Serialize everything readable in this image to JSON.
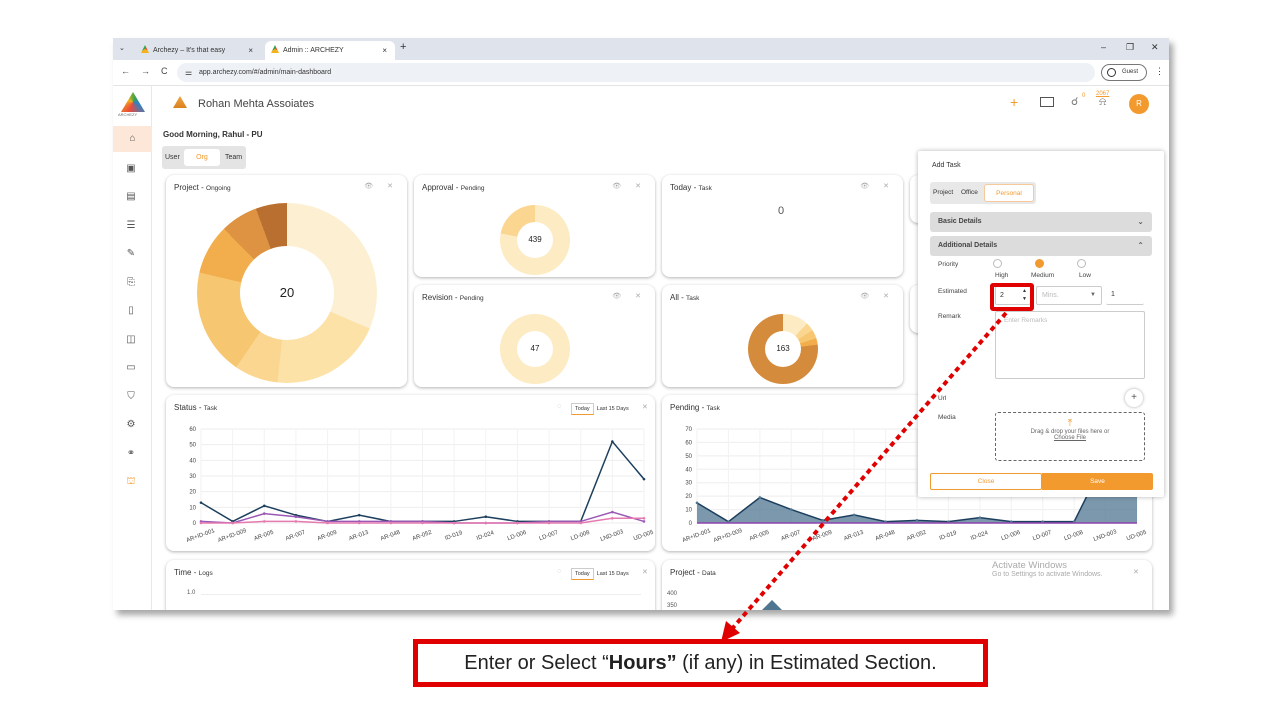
{
  "browser": {
    "tabs": [
      {
        "title": "Archezy – It's that easy",
        "close": "×"
      },
      {
        "title": "Admin :: ARCHEZY",
        "close": "×"
      }
    ],
    "new_tab": "+",
    "dropdown_glyph": "⌄",
    "window_controls": {
      "minimize": "–",
      "restore": "❐",
      "close": "✕"
    },
    "nav": {
      "back": "←",
      "forward": "→",
      "reload": "C"
    },
    "site_icon": "⚌",
    "url": "app.archezy.com/#/admin/main-dashboard",
    "profile_label": "Guest",
    "menu_glyph": "⋮"
  },
  "sidebar": {
    "logo_text": "ARCHEZY",
    "icons": [
      "home-icon",
      "badge-icon",
      "clipboard-icon",
      "list-icon",
      "edit-icon",
      "report-icon",
      "book-icon",
      "briefcase-icon",
      "folder-icon",
      "shield-icon",
      "doc-settings-icon",
      "network-icon",
      "building-icon"
    ],
    "glyphs": [
      "⌂",
      "▣",
      "▤",
      "☰",
      "✎",
      "⎘",
      "▯",
      "◫",
      "▭",
      "⛉",
      "⚙",
      "⚭",
      "⛫"
    ]
  },
  "header": {
    "org_name": "Rohan Mehta Assoiates",
    "plus": "+",
    "chat_glyph": "☌",
    "chat_count": "0",
    "bell_glyph": "⍾",
    "bell_count": "2067",
    "avatar_initial": "R"
  },
  "greeting": "Good Morning, Rahul - PU",
  "view_toggle": {
    "user": "User",
    "org": "Org",
    "team": "Team"
  },
  "cards": {
    "project": {
      "title": "Project",
      "sub": "Ongoing",
      "center": "20"
    },
    "approval": {
      "title": "Approval",
      "sub": "Pending",
      "center": "439"
    },
    "today": {
      "title": "Today",
      "sub": "Task",
      "center": "0"
    },
    "revision": {
      "title": "Revision",
      "sub": "Pending",
      "center": "47"
    },
    "all": {
      "title": "All",
      "sub": "Task",
      "center": "163"
    },
    "status": {
      "title": "Status",
      "sub": "Task",
      "today": "Today",
      "last15": "Last 15 Days"
    },
    "pending": {
      "title": "Pending",
      "sub": "Task"
    },
    "time": {
      "title": "Time",
      "sub": "Logs",
      "today": "Today",
      "last15": "Last 15 Days",
      "ytick": "1.0"
    },
    "projectdata": {
      "title": "Project",
      "sub": "Data",
      "yticks": [
        "400",
        "350"
      ]
    },
    "card_icons": "👁 ✕"
  },
  "chart_data": [
    {
      "type": "line",
      "title": "Status - Task",
      "categories": [
        "AR+ID-001",
        "AR+ID-009",
        "AR-005",
        "AR-007",
        "AR-009",
        "AR-013",
        "AR-048",
        "AR-052",
        "ID-019",
        "ID-024",
        "LD-006",
        "LD-007",
        "LD-008",
        "LND-003",
        "UD-005"
      ],
      "ylim": [
        0,
        60
      ],
      "yticks": [
        "60",
        "50",
        "40",
        "30",
        "20",
        "10",
        "0"
      ],
      "series": [
        {
          "color": "#1d3f5e",
          "values": [
            13,
            1,
            11,
            5,
            1,
            5,
            1,
            1,
            1,
            4,
            1,
            1,
            1,
            52,
            28
          ]
        },
        {
          "color": "#9b59b6",
          "values": [
            1,
            0,
            6,
            4,
            1,
            1,
            1,
            1,
            0,
            0,
            0,
            1,
            1,
            7,
            1
          ]
        },
        {
          "color": "#e57ab0",
          "values": [
            0,
            0,
            1,
            1,
            0,
            0,
            0,
            0,
            0,
            0,
            0,
            0,
            0,
            3,
            3
          ]
        }
      ]
    },
    {
      "type": "area",
      "title": "Pending - Task",
      "categories": [
        "AR+ID-001",
        "AR+ID-009",
        "AR-005",
        "AR-007",
        "AR-009",
        "AR-013",
        "AR-048",
        "AR-052",
        "ID-019",
        "ID-024",
        "LD-006",
        "LD-007",
        "LD-008",
        "LND-003",
        "UD-005"
      ],
      "ylim": [
        0,
        70
      ],
      "yticks": [
        "70",
        "60",
        "50",
        "40",
        "30",
        "20",
        "10",
        "0"
      ],
      "series": [
        {
          "color": "#4f7590",
          "values": [
            15,
            1,
            19,
            10,
            2,
            6,
            1,
            2,
            1,
            4,
            1,
            1,
            1,
            48,
            48
          ]
        }
      ]
    },
    {
      "type": "pie",
      "title": "Project - Ongoing",
      "values": [
        28,
        18,
        7,
        17,
        8,
        6,
        5
      ],
      "colors": [
        "#fdf0d2",
        "#fde2a8",
        "#fbd690",
        "#f6c671",
        "#f2ad4c",
        "#dd9341",
        "#b96f2f"
      ]
    }
  ],
  "add_task": {
    "title": "Add Task",
    "tabs": {
      "project": "Project",
      "office": "Office",
      "personal": "Personal"
    },
    "basic": "Basic Details",
    "additional": "Additional Details",
    "priority_label": "Priority",
    "priorities": [
      "High",
      "Medium",
      "Low"
    ],
    "estimated_label": "Estimated",
    "hours_value": "2",
    "mins_placeholder": "Mins.",
    "extra_value": "1",
    "remark_label": "Remark",
    "remark_placeholder": "Enter Remarks",
    "url_label": "Url",
    "media_label": "Media",
    "dropzone_text": "Drag & drop your files here or",
    "choose_file": "Choose File",
    "close_btn": "Close",
    "save_btn": "Save"
  },
  "watermark": {
    "line1": "Activate Windows",
    "line2": "Go to Settings to activate Windows."
  },
  "callout": {
    "prefix": "Enter or Select “",
    "bold": "Hours”",
    "suffix": " (if any) in Estimated Section."
  }
}
